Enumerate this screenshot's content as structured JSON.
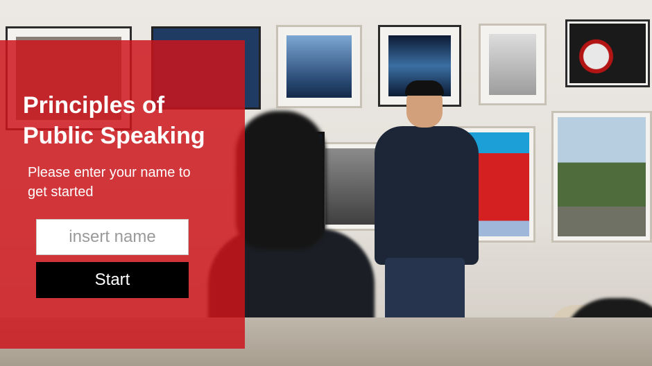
{
  "lesson": {
    "title": "Principles of Public Speaking",
    "prompt": "Please enter your name to get started"
  },
  "form": {
    "name_value": "",
    "name_placeholder": "insert name",
    "start_label": "Start"
  },
  "colors": {
    "panel_accent": "#cd141c",
    "button_background": "#000000",
    "button_text": "#ffffff",
    "input_background": "#ffffff",
    "placeholder_text": "#9a9a9a"
  },
  "background": {
    "image_description_icon": "presentation-photo"
  }
}
